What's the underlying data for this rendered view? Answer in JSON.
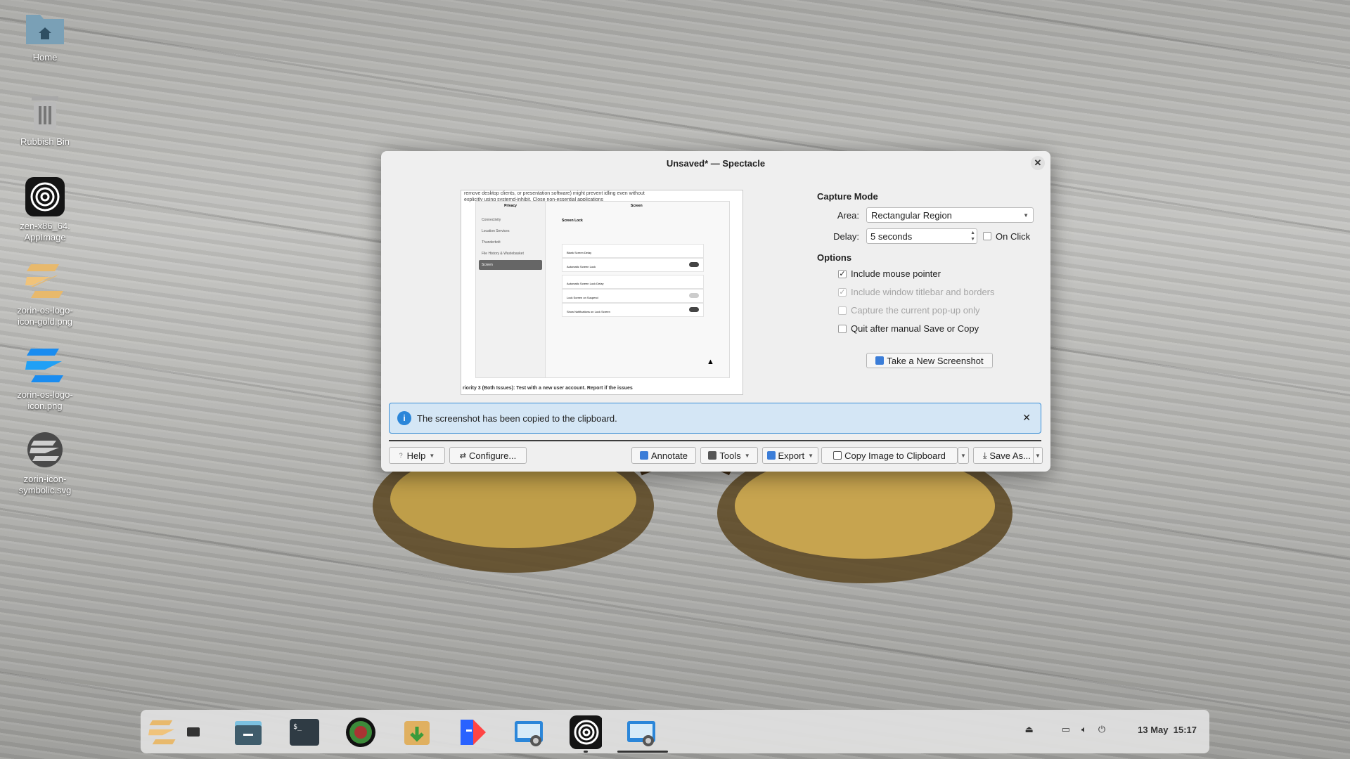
{
  "desktop": {
    "icons": [
      {
        "label": "Home",
        "icon": "home-folder-icon"
      },
      {
        "label": "Rubbish Bin",
        "icon": "trash-icon"
      },
      {
        "label": "zen-x86_64.\nAppImage",
        "icon": "zen-browser-icon"
      },
      {
        "label": "zorin-os-logo-\nicon-gold.png",
        "icon": "zorin-logo-gold-icon"
      },
      {
        "label": "zorin-os-logo-\nicon.png",
        "icon": "zorin-logo-blue-icon"
      },
      {
        "label": "zorin-icon-\nsymbolic.svg",
        "icon": "zorin-logo-symbolic-icon"
      }
    ]
  },
  "window": {
    "title": "Unsaved* — Spectacle",
    "capture_mode": {
      "heading": "Capture Mode",
      "area_label": "Area:",
      "area_value": "Rectangular Region",
      "delay_label": "Delay:",
      "delay_value": "5 seconds",
      "on_click_label": "On Click",
      "on_click_checked": false
    },
    "options": {
      "heading": "Options",
      "items": [
        {
          "label": "Include mouse pointer",
          "checked": true,
          "enabled": true
        },
        {
          "label": "Include window titlebar and borders",
          "checked": true,
          "enabled": false
        },
        {
          "label": "Capture the current pop-up only",
          "checked": false,
          "enabled": false
        },
        {
          "label": "Quit after manual Save or Copy",
          "checked": false,
          "enabled": true
        }
      ]
    },
    "new_screenshot_label": "Take a New Screenshot",
    "info_message": "The screenshot has been copied to the clipboard.",
    "toolbar": {
      "help": "Help",
      "configure": "Configure...",
      "annotate": "Annotate",
      "tools": "Tools",
      "export": "Export",
      "copy_image": "Copy Image to Clipboard",
      "save_as": "Save As..."
    },
    "preview": {
      "top_text": "remove desktop clients, or presentation software) might prevent idling even without explicitly using systemd-inhibit. Close non-essential applications",
      "side_title": "Privacy",
      "main_title": "Screen",
      "side_items": [
        "Connectivity",
        "Location Services",
        "Thunderbolt",
        "File History & Wastebasket",
        "Screen"
      ],
      "section": "Screen Lock",
      "rows": [
        "Blank Screen Delay",
        "Automatic Screen Lock",
        "Automatic Screen Lock Delay",
        "Lock Screen on Suspend",
        "Show Notifications on Lock Screen"
      ],
      "bottom_text": "riority 3 (Both Issues): Test with a new user account. Report if the issues"
    }
  },
  "taskbar": {
    "items": [
      "zorin-menu-icon",
      "show-desktop-icon",
      "files-icon",
      "terminal-icon",
      "color-picker-icon",
      "software-store-icon",
      "code-editor-icon",
      "spectacle-icon",
      "zen-browser-icon",
      "spectacle-active-icon"
    ],
    "date": "13 May",
    "time": "15:17"
  }
}
